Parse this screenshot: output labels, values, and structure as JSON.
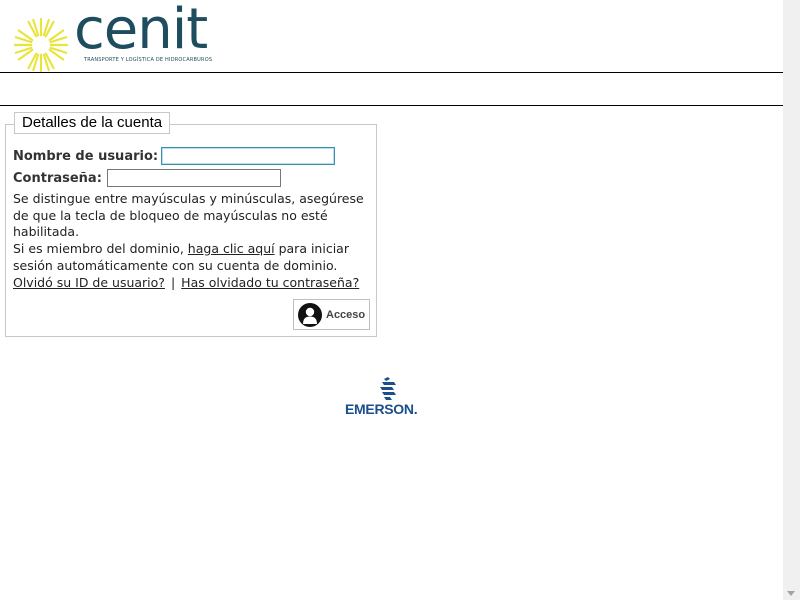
{
  "header": {
    "logo_word": "cenit",
    "logo_tagline": "TRANSPORTE Y LOGÍSTICA DE HIDROCARBUROS",
    "brand_color": "#1d4d5e",
    "sun_color": "#e8e43a"
  },
  "account": {
    "legend": "Detalles de la cuenta",
    "username_label": "Nombre de usuario:",
    "username_value": "",
    "password_label": "Contraseña:",
    "password_value": "",
    "case_note": "Se distingue entre mayúsculas y minúsculas, asegúrese de que la tecla de bloqueo de mayúsculas no esté habilitada.",
    "domain_prefix": "Si es miembro del dominio, ",
    "domain_link": "haga clic aquí",
    "domain_suffix": " para iniciar sesión automáticamente con su cuenta de dominio.",
    "forgot_id_link": "Olvidó su ID de usuario?",
    "separator": "|",
    "forgot_password_link": "Has olvidado tu contraseña?",
    "login_button": "Acceso"
  },
  "footer": {
    "emerson_word": "EMERSON",
    "emerson_dot": ".",
    "emerson_color": "#1a4f8c"
  }
}
